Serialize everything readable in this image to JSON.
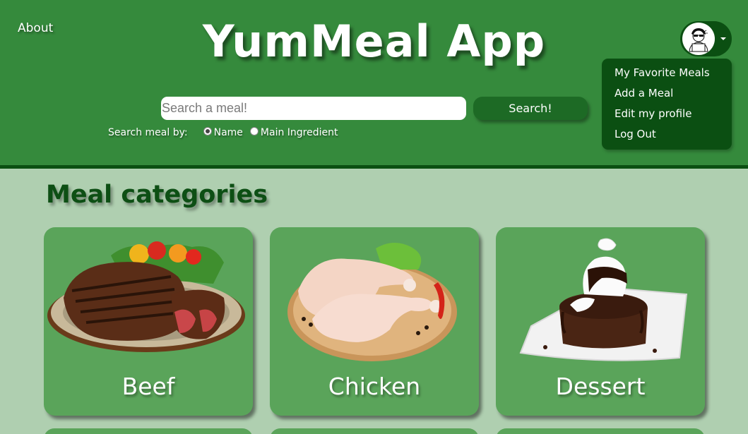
{
  "header": {
    "about_label": "About",
    "app_title": "YumMeal App"
  },
  "search": {
    "placeholder": "Search a meal!",
    "value": "",
    "button_label": "Search!",
    "by_label": "Search meal by:",
    "options": [
      {
        "label": "Name",
        "selected": true
      },
      {
        "label": "Main Ingredient",
        "selected": false
      }
    ]
  },
  "profile_menu": {
    "avatar_icon": "developer-avatar-icon",
    "items": [
      {
        "label": "My Favorite Meals"
      },
      {
        "label": "Add a Meal"
      },
      {
        "label": "Edit my profile"
      },
      {
        "label": "Log Out"
      }
    ]
  },
  "main": {
    "section_title": "Meal categories",
    "categories": [
      {
        "name": "Beef",
        "image": "steak-plate"
      },
      {
        "name": "Chicken",
        "image": "raw-chicken-legs"
      },
      {
        "name": "Dessert",
        "image": "chocolate-lava-cake"
      }
    ]
  },
  "colors": {
    "header_bg": "#358a3c",
    "page_bg": "#afcfb0",
    "dark_green": "#0b4f12",
    "card_bg": "#5aa45a"
  }
}
